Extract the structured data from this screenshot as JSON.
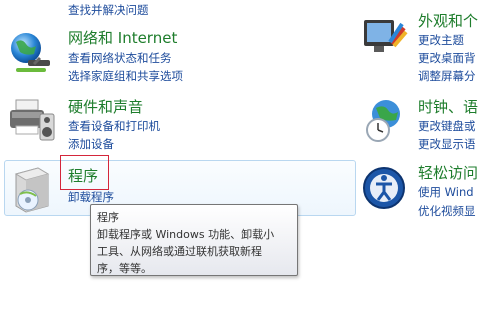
{
  "left": {
    "top_link": "查找并解决问题",
    "network": {
      "title": "网络和 Internet",
      "links": [
        "查看网络状态和任务",
        "选择家庭组和共享选项"
      ]
    },
    "hardware": {
      "title": "硬件和声音",
      "links": [
        "查看设备和打印机",
        "添加设备"
      ]
    },
    "programs": {
      "title": "程序",
      "links": [
        "卸载程序"
      ]
    }
  },
  "right": {
    "appearance": {
      "title": "外观和个",
      "links": [
        "更改主题",
        "更改桌面背",
        "调整屏幕分"
      ]
    },
    "clock": {
      "title": "时钟、语",
      "links": [
        "更改键盘或",
        "更改显示语"
      ]
    },
    "ease": {
      "title": "轻松访问",
      "links": [
        "使用 Wind",
        "优化视频显"
      ]
    }
  },
  "tooltip": {
    "title": "程序",
    "lines": [
      "卸载程序或 Windows 功能、卸载小",
      "工具、从网络或通过联机获取新程",
      "序，等等。"
    ]
  }
}
